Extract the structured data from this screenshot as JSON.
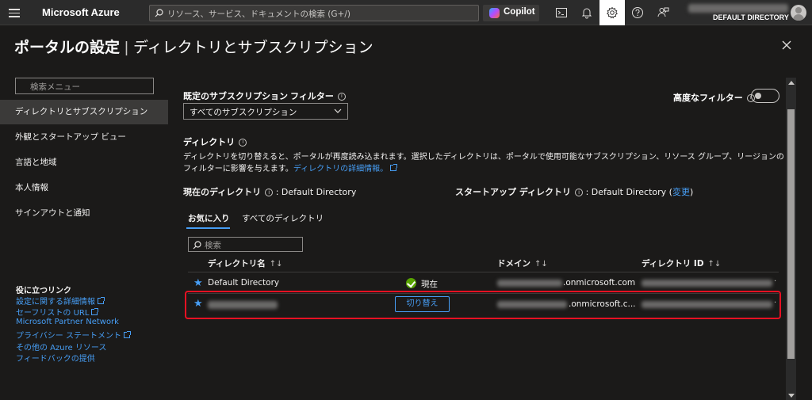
{
  "topbar": {
    "brand": "Microsoft Azure",
    "search_placeholder": "リソース、サービス、ドキュメントの検索 (G+/)",
    "copilot_label": "Copilot",
    "directory_label": "DEFAULT DIRECTORY"
  },
  "page": {
    "title_bold": "ポータルの設定",
    "title_sep": "|",
    "title_rest": "ディレクトリとサブスクリプション"
  },
  "sidebar": {
    "search_placeholder": "検索メニュー",
    "items": [
      {
        "label": "ディレクトリとサブスクリプション"
      },
      {
        "label": "外観とスタートアップ ビュー"
      },
      {
        "label": "言語と地域"
      },
      {
        "label": "本人情報"
      },
      {
        "label": "サインアウトと通知"
      }
    ],
    "links_heading": "役に立つリンク",
    "links": [
      {
        "label": "設定に関する詳細情報"
      },
      {
        "label": "セーフリストの URL"
      },
      {
        "label": "Microsoft Partner Network"
      },
      {
        "label": "プライバシー ステートメント"
      },
      {
        "label": "その他の Azure リソース"
      },
      {
        "label": "フィードバックの提供"
      }
    ]
  },
  "main": {
    "filter_label": "既定のサブスクリプション フィルター",
    "filter_value": "すべてのサブスクリプション",
    "advanced_filter_label": "高度なフィルター",
    "directory_heading": "ディレクトリ",
    "description": "ディレクトリを切り替えると、ポータルが再度読み込まれます。選択したディレクトリは、ポータルで使用可能なサブスクリプション、リソース グループ、リージョンのフィルターに影響を与えます。",
    "description_link": "ディレクトリの詳細情報。",
    "current_dir_label": "現在のディレクトリ",
    "current_dir_value": ": Default Directory",
    "startup_dir_label": "スタートアップ ディレクトリ",
    "startup_dir_value": ": Default Directory (",
    "startup_change_link": "変更",
    "startup_close_paren": ")",
    "tabs": [
      {
        "label": "お気に入り"
      },
      {
        "label": "すべてのディレクトリ"
      }
    ],
    "table_search_placeholder": "検索",
    "columns": {
      "name": "ディレクトリ名",
      "domain": "ドメイン",
      "id": "ディレクトリ ID",
      "sort_glyph": "↑↓"
    },
    "rows": [
      {
        "name": "Default Directory",
        "status": "現在",
        "domain_suffix": ".onmicrosoft.com"
      },
      {
        "name": "",
        "action": "切り替え",
        "domain_suffix": ".onmicrosoft.c..."
      }
    ]
  },
  "icons": {
    "hamburger": "hamburger-menu-icon",
    "search": "search-icon",
    "terminal": "cloud-shell-icon",
    "bell": "notifications-icon",
    "gear": "settings-icon",
    "help": "help-icon",
    "feedback": "feedback-icon",
    "close": "close-icon",
    "star": "star-icon"
  },
  "colors": {
    "accent": "#479ef5",
    "highlight_box": "#e81123",
    "success": "#57a300",
    "background": "#1b1a19"
  }
}
